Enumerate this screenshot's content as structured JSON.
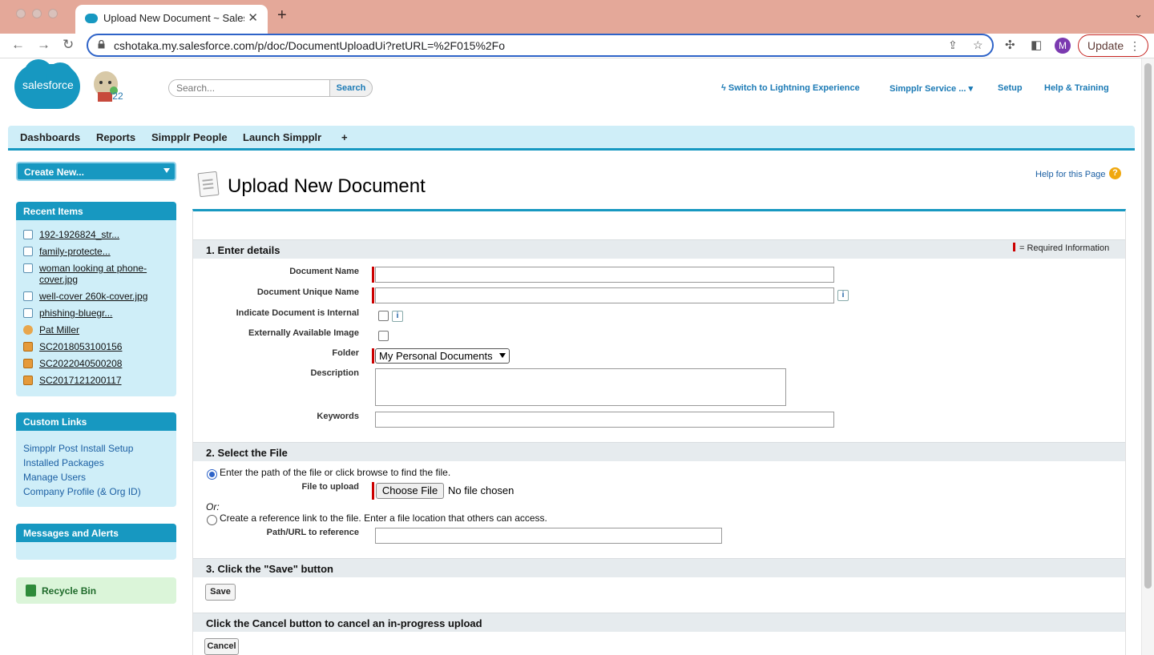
{
  "browser": {
    "tab_title": "Upload New Document ~ Salesforce",
    "url": "cshotaka.my.salesforce.com/p/doc/DocumentUploadUi?retURL=%2F015%2Fo",
    "profile_initial": "M",
    "update_label": "Update"
  },
  "header": {
    "logo_text": "salesforce",
    "mascot_tag": "'22",
    "search_placeholder": "Search...",
    "search_button": "Search",
    "links": {
      "lightning": "Switch to Lightning Experience",
      "app_menu": "Simpplr Service ...",
      "setup": "Setup",
      "help": "Help & Training"
    }
  },
  "tabs": [
    "Dashboards",
    "Reports",
    "Simpplr People",
    "Launch Simpplr",
    "+"
  ],
  "sidebar": {
    "create_new": "Create New...",
    "recent_title": "Recent Items",
    "recent_items": [
      {
        "label": "192-1926824_str...",
        "icon": "document-icon"
      },
      {
        "label": "family-protecte...",
        "icon": "document-icon"
      },
      {
        "label": "woman looking at phone-",
        "label2": "cover.jpg",
        "icon": "document-icon"
      },
      {
        "label": "well-cover 260k-cover.jpg",
        "icon": "document-icon"
      },
      {
        "label": "phishing-bluegr...",
        "icon": "document-icon"
      },
      {
        "label": "Pat Miller",
        "icon": "person-icon"
      },
      {
        "label": "SC2018053100156",
        "icon": "case-icon"
      },
      {
        "label": "SC2022040500208",
        "icon": "case-icon"
      },
      {
        "label": "SC2017121200117",
        "icon": "case-icon"
      }
    ],
    "custom_links_title": "Custom Links",
    "custom_links": [
      "Simpplr Post Install Setup",
      "Installed Packages",
      "Manage Users",
      "Company Profile (& Org ID)"
    ],
    "messages_title": "Messages and Alerts",
    "recycle_bin": "Recycle Bin"
  },
  "page": {
    "title": "Upload New Document",
    "help_link": "Help for this Page",
    "help_icon": "?",
    "required_legend": "= Required Information",
    "section1": "1. Enter details",
    "fields": {
      "document_name": "Document Name",
      "unique_name": "Document Unique Name",
      "is_internal": "Indicate Document is Internal",
      "external_image": "Externally Available Image",
      "folder": "Folder",
      "folder_value": "My Personal Documents",
      "description": "Description",
      "keywords": "Keywords"
    },
    "info_icon": "i",
    "section2": "2. Select the File",
    "radio_file": "Enter the path of the file or click browse to find the file.",
    "file_to_upload": "File to upload",
    "choose_file": "Choose File",
    "no_file": "No file chosen",
    "or_label": "Or:",
    "radio_link": "Create a reference link to the file. Enter a file location that others can access.",
    "path_url": "Path/URL to reference",
    "section3": "3. Click the \"Save\" button",
    "save": "Save",
    "section4": "Click the Cancel button to cancel an in-progress upload",
    "cancel": "Cancel"
  }
}
